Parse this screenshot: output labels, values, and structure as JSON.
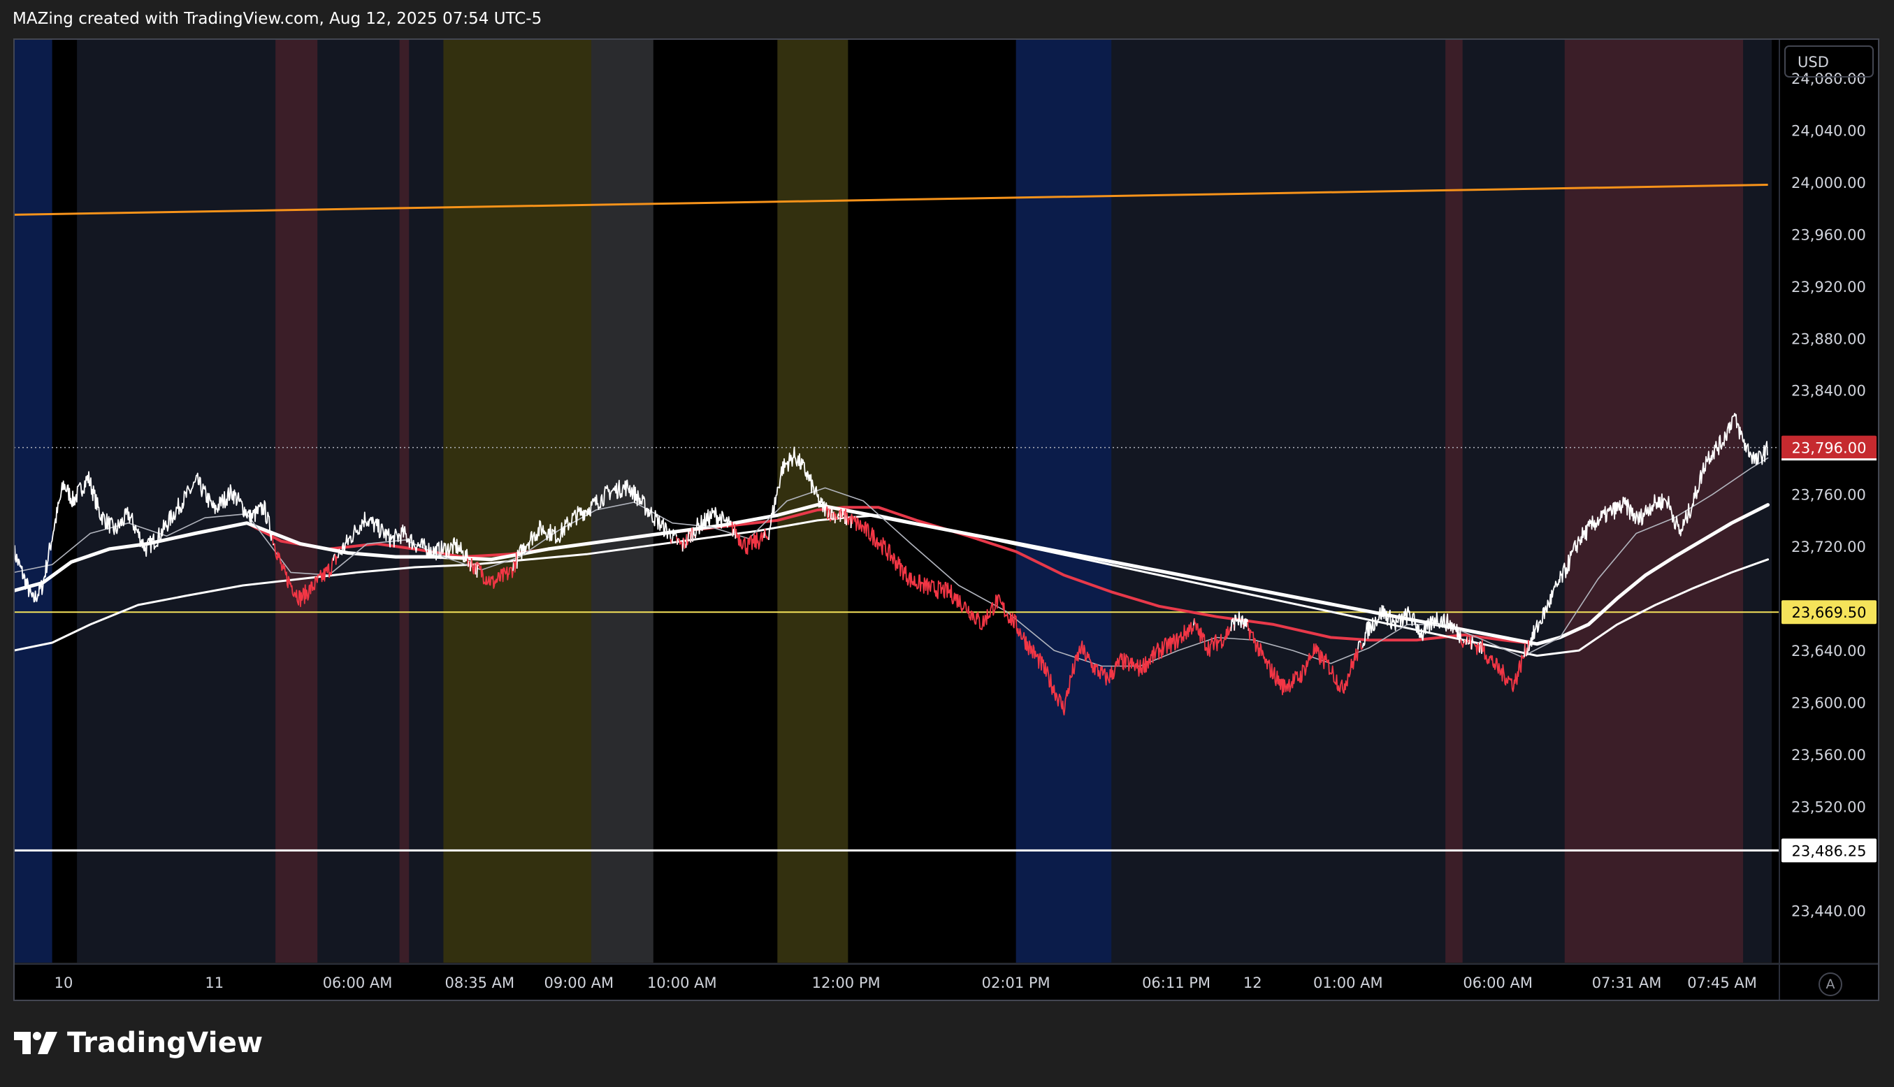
{
  "header": {
    "attribution": "MAZing created with TradingView.com, Aug 12, 2025 07:54 UTC-5"
  },
  "brand": {
    "name": "TradingView",
    "icon": "tradingview-logo-icon"
  },
  "auto_scale_label": "A",
  "colors": {
    "background": "#1f1f1f",
    "pane": "#000000",
    "price_up": "#ffffff",
    "price_down": "#f23645",
    "ma_red": "#e8394a",
    "trendline": "#f7931a",
    "hline_yellow": "#f5e35a",
    "hline_white": "#ffffff",
    "badge_current": "#c62a2f"
  },
  "chart_data": {
    "type": "line",
    "currency": "USD",
    "ylim": [
      23400,
      24110
    ],
    "y_ticks": [
      {
        "value": 24080,
        "label": "24,080.00"
      },
      {
        "value": 24040,
        "label": "24,040.00"
      },
      {
        "value": 24000,
        "label": "24,000.00"
      },
      {
        "value": 23960,
        "label": "23,960.00"
      },
      {
        "value": 23920,
        "label": "23,920.00"
      },
      {
        "value": 23880,
        "label": "23,880.00"
      },
      {
        "value": 23840,
        "label": "23,840.00"
      },
      {
        "value": 23760,
        "label": "23,760.00"
      },
      {
        "value": 23720,
        "label": "23,720.00"
      },
      {
        "value": 23640,
        "label": "23,640.00"
      },
      {
        "value": 23600,
        "label": "23,600.00"
      },
      {
        "value": 23560,
        "label": "23,560.00"
      },
      {
        "value": 23520,
        "label": "23,520.00"
      },
      {
        "value": 23440,
        "label": "23,440.00"
      }
    ],
    "x_labels": [
      {
        "x": 52,
        "label": "10"
      },
      {
        "x": 210,
        "label": "11"
      },
      {
        "x": 360,
        "label": "06:00 AM"
      },
      {
        "x": 488,
        "label": "08:35 AM"
      },
      {
        "x": 592,
        "label": "09:00 AM"
      },
      {
        "x": 700,
        "label": "10:00 AM"
      },
      {
        "x": 872,
        "label": "12:00 PM"
      },
      {
        "x": 1050,
        "label": "02:01 PM"
      },
      {
        "x": 1218,
        "label": "06:11 PM"
      },
      {
        "x": 1298,
        "label": "12"
      },
      {
        "x": 1398,
        "label": "01:00 AM"
      },
      {
        "x": 1555,
        "label": "06:00 AM"
      },
      {
        "x": 1690,
        "label": "07:31 AM"
      },
      {
        "x": 1790,
        "label": "07:45 AM"
      }
    ],
    "x_range": [
      0,
      1850
    ],
    "badges": [
      {
        "value": 23796.0,
        "label": "23,796.00",
        "style": "current"
      },
      {
        "value": 23669.5,
        "label": "23,669.50",
        "style": "yellow"
      },
      {
        "value": 23486.25,
        "label": "23,486.25",
        "style": "white"
      }
    ],
    "current_price": 23796.0,
    "horizontal_lines": [
      {
        "value": 23669.5,
        "color": "#f5e35a"
      },
      {
        "value": 23486.25,
        "color": "#ffffff"
      }
    ],
    "trendline": {
      "start": [
        0,
        23975
      ],
      "end": [
        1838,
        23998
      ],
      "color": "#f7931a"
    },
    "session_bands": [
      {
        "x0": 0,
        "x1": 40,
        "color": "#0b1c4a"
      },
      {
        "x0": 40,
        "x1": 66,
        "color": "#000000"
      },
      {
        "x0": 66,
        "x1": 274,
        "color": "#131722"
      },
      {
        "x0": 274,
        "x1": 318,
        "color": "#3b1e28"
      },
      {
        "x0": 318,
        "x1": 404,
        "color": "#131722"
      },
      {
        "x0": 404,
        "x1": 414,
        "color": "#3b1e28"
      },
      {
        "x0": 414,
        "x1": 450,
        "color": "#131722"
      },
      {
        "x0": 450,
        "x1": 605,
        "color": "#33300f"
      },
      {
        "x0": 605,
        "x1": 670,
        "color": "#2a2b2e"
      },
      {
        "x0": 670,
        "x1": 800,
        "color": "#000000"
      },
      {
        "x0": 800,
        "x1": 874,
        "color": "#33300f"
      },
      {
        "x0": 874,
        "x1": 1050,
        "color": "#000000"
      },
      {
        "x0": 1050,
        "x1": 1150,
        "color": "#0b1c4a"
      },
      {
        "x0": 1150,
        "x1": 1500,
        "color": "#131722"
      },
      {
        "x0": 1500,
        "x1": 1518,
        "color": "#3b1e28"
      },
      {
        "x0": 1518,
        "x1": 1625,
        "color": "#131722"
      },
      {
        "x0": 1625,
        "x1": 1812,
        "color": "#3b1e28"
      },
      {
        "x0": 1812,
        "x1": 1842,
        "color": "#131722"
      },
      {
        "x0": 1842,
        "x1": 1850,
        "color": "#000000"
      }
    ],
    "price_series": {
      "name": "",
      "color_up": "#ffffff",
      "color_down": "#f23645",
      "keypoints": [
        [
          0,
          23716
        ],
        [
          20,
          23678
        ],
        [
          30,
          23690
        ],
        [
          42,
          23735
        ],
        [
          52,
          23768
        ],
        [
          62,
          23755
        ],
        [
          78,
          23773
        ],
        [
          90,
          23745
        ],
        [
          106,
          23732
        ],
        [
          120,
          23745
        ],
        [
          138,
          23718
        ],
        [
          152,
          23728
        ],
        [
          170,
          23748
        ],
        [
          192,
          23770
        ],
        [
          210,
          23748
        ],
        [
          228,
          23762
        ],
        [
          248,
          23742
        ],
        [
          262,
          23750
        ],
        [
          282,
          23700
        ],
        [
          300,
          23680
        ],
        [
          312,
          23688
        ],
        [
          328,
          23700
        ],
        [
          348,
          23722
        ],
        [
          368,
          23742
        ],
        [
          385,
          23732
        ],
        [
          396,
          23725
        ],
        [
          408,
          23730
        ],
        [
          420,
          23722
        ],
        [
          440,
          23716
        ],
        [
          464,
          23720
        ],
        [
          480,
          23706
        ],
        [
          502,
          23692
        ],
        [
          520,
          23700
        ],
        [
          536,
          23722
        ],
        [
          552,
          23734
        ],
        [
          570,
          23728
        ],
        [
          586,
          23742
        ],
        [
          604,
          23750
        ],
        [
          624,
          23762
        ],
        [
          644,
          23766
        ],
        [
          662,
          23750
        ],
        [
          680,
          23735
        ],
        [
          700,
          23720
        ],
        [
          716,
          23735
        ],
        [
          734,
          23745
        ],
        [
          750,
          23736
        ],
        [
          768,
          23720
        ],
        [
          790,
          23728
        ],
        [
          805,
          23780
        ],
        [
          818,
          23790
        ],
        [
          830,
          23777
        ],
        [
          845,
          23752
        ],
        [
          858,
          23745
        ],
        [
          872,
          23742
        ],
        [
          888,
          23735
        ],
        [
          905,
          23725
        ],
        [
          920,
          23712
        ],
        [
          940,
          23694
        ],
        [
          960,
          23688
        ],
        [
          980,
          23685
        ],
        [
          1000,
          23672
        ],
        [
          1014,
          23660
        ],
        [
          1030,
          23678
        ],
        [
          1048,
          23662
        ],
        [
          1062,
          23645
        ],
        [
          1078,
          23628
        ],
        [
          1090,
          23610
        ],
        [
          1100,
          23595
        ],
        [
          1108,
          23620
        ],
        [
          1118,
          23642
        ],
        [
          1130,
          23628
        ],
        [
          1146,
          23618
        ],
        [
          1160,
          23632
        ],
        [
          1180,
          23626
        ],
        [
          1200,
          23640
        ],
        [
          1220,
          23648
        ],
        [
          1236,
          23660
        ],
        [
          1252,
          23642
        ],
        [
          1268,
          23650
        ],
        [
          1282,
          23665
        ],
        [
          1295,
          23655
        ],
        [
          1312,
          23630
        ],
        [
          1330,
          23612
        ],
        [
          1348,
          23620
        ],
        [
          1362,
          23640
        ],
        [
          1378,
          23628
        ],
        [
          1392,
          23610
        ],
        [
          1404,
          23632
        ],
        [
          1418,
          23655
        ],
        [
          1434,
          23670
        ],
        [
          1448,
          23660
        ],
        [
          1462,
          23668
        ],
        [
          1476,
          23652
        ],
        [
          1490,
          23665
        ],
        [
          1506,
          23660
        ],
        [
          1520,
          23648
        ],
        [
          1538,
          23642
        ],
        [
          1556,
          23625
        ],
        [
          1572,
          23614
        ],
        [
          1584,
          23640
        ],
        [
          1598,
          23660
        ],
        [
          1612,
          23682
        ],
        [
          1626,
          23702
        ],
        [
          1640,
          23725
        ],
        [
          1656,
          23738
        ],
        [
          1672,
          23746
        ],
        [
          1688,
          23752
        ],
        [
          1702,
          23740
        ],
        [
          1716,
          23752
        ],
        [
          1732,
          23756
        ],
        [
          1746,
          23730
        ],
        [
          1760,
          23755
        ],
        [
          1774,
          23788
        ],
        [
          1790,
          23800
        ],
        [
          1802,
          23820
        ],
        [
          1814,
          23798
        ],
        [
          1826,
          23785
        ],
        [
          1838,
          23795
        ]
      ]
    },
    "moving_averages": [
      {
        "name": "",
        "color": "#e8394a",
        "width": 4,
        "points": [
          [
            244,
            23738
          ],
          [
            280,
            23724
          ],
          [
            330,
            23718
          ],
          [
            380,
            23722
          ],
          [
            420,
            23718
          ],
          [
            470,
            23712
          ],
          [
            520,
            23714
          ],
          [
            560,
            23718
          ],
          [
            620,
            23724
          ],
          [
            680,
            23730
          ],
          [
            740,
            23735
          ],
          [
            800,
            23740
          ],
          [
            842,
            23748
          ],
          [
            870,
            23750
          ],
          [
            906,
            23750
          ],
          [
            946,
            23740
          ],
          [
            1000,
            23728
          ],
          [
            1050,
            23716
          ],
          [
            1100,
            23698
          ],
          [
            1150,
            23685
          ],
          [
            1200,
            23674
          ],
          [
            1260,
            23666
          ],
          [
            1320,
            23660
          ],
          [
            1380,
            23650
          ],
          [
            1420,
            23648
          ],
          [
            1470,
            23648
          ],
          [
            1520,
            23652
          ],
          [
            1560,
            23648
          ],
          [
            1596,
            23645
          ]
        ]
      },
      {
        "name": "",
        "color": "#ffffff",
        "width": 5,
        "points": [
          [
            0,
            23686
          ],
          [
            30,
            23692
          ],
          [
            60,
            23708
          ],
          [
            100,
            23718
          ],
          [
            140,
            23722
          ],
          [
            190,
            23730
          ],
          [
            244,
            23738
          ],
          [
            300,
            23722
          ],
          [
            350,
            23715
          ],
          [
            400,
            23712
          ],
          [
            440,
            23712
          ],
          [
            500,
            23710
          ],
          [
            560,
            23718
          ],
          [
            620,
            23724
          ],
          [
            680,
            23730
          ],
          [
            740,
            23736
          ],
          [
            800,
            23744
          ],
          [
            842,
            23752
          ],
          [
            870,
            23748
          ],
          [
            1596,
            23645
          ],
          [
            1620,
            23650
          ],
          [
            1650,
            23660
          ],
          [
            1680,
            23680
          ],
          [
            1710,
            23698
          ],
          [
            1740,
            23712
          ],
          [
            1770,
            23725
          ],
          [
            1800,
            23738
          ],
          [
            1838,
            23752
          ]
        ]
      },
      {
        "name": "",
        "color": "#ffffff",
        "width": 3,
        "points": [
          [
            0,
            23640
          ],
          [
            40,
            23646
          ],
          [
            80,
            23660
          ],
          [
            130,
            23675
          ],
          [
            180,
            23682
          ],
          [
            240,
            23690
          ],
          [
            300,
            23695
          ],
          [
            360,
            23700
          ],
          [
            420,
            23704
          ],
          [
            480,
            23706
          ],
          [
            540,
            23710
          ],
          [
            600,
            23714
          ],
          [
            660,
            23720
          ],
          [
            720,
            23726
          ],
          [
            780,
            23732
          ],
          [
            842,
            23740
          ],
          [
            870,
            23742
          ],
          [
            906,
            23744
          ],
          [
            1596,
            23636
          ],
          [
            1640,
            23640
          ],
          [
            1680,
            23660
          ],
          [
            1720,
            23675
          ],
          [
            1760,
            23688
          ],
          [
            1800,
            23700
          ],
          [
            1838,
            23710
          ]
        ]
      },
      {
        "name": "",
        "color": "#b2b5be",
        "width": 1.6,
        "points": [
          [
            0,
            23700
          ],
          [
            40,
            23706
          ],
          [
            80,
            23730
          ],
          [
            120,
            23738
          ],
          [
            160,
            23728
          ],
          [
            200,
            23742
          ],
          [
            244,
            23745
          ],
          [
            290,
            23700
          ],
          [
            330,
            23698
          ],
          [
            370,
            23722
          ],
          [
            410,
            23725
          ],
          [
            450,
            23712
          ],
          [
            490,
            23702
          ],
          [
            530,
            23712
          ],
          [
            570,
            23732
          ],
          [
            610,
            23748
          ],
          [
            650,
            23754
          ],
          [
            690,
            23738
          ],
          [
            730,
            23735
          ],
          [
            770,
            23726
          ],
          [
            810,
            23755
          ],
          [
            850,
            23765
          ],
          [
            890,
            23755
          ],
          [
            940,
            23722
          ],
          [
            990,
            23690
          ],
          [
            1040,
            23670
          ],
          [
            1090,
            23640
          ],
          [
            1140,
            23628
          ],
          [
            1180,
            23628
          ],
          [
            1220,
            23640
          ],
          [
            1260,
            23650
          ],
          [
            1300,
            23648
          ],
          [
            1340,
            23640
          ],
          [
            1380,
            23630
          ],
          [
            1420,
            23642
          ],
          [
            1460,
            23660
          ],
          [
            1500,
            23660
          ],
          [
            1540,
            23648
          ],
          [
            1580,
            23635
          ],
          [
            1620,
            23650
          ],
          [
            1660,
            23695
          ],
          [
            1700,
            23730
          ],
          [
            1740,
            23742
          ],
          [
            1780,
            23760
          ],
          [
            1820,
            23780
          ],
          [
            1838,
            23788
          ]
        ]
      }
    ]
  }
}
